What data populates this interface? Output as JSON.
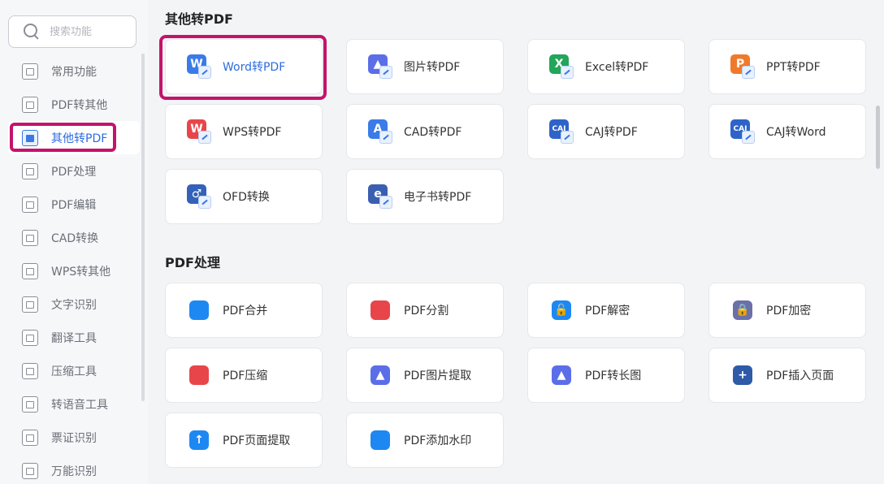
{
  "search": {
    "placeholder": "搜索功能"
  },
  "sidebar": {
    "items": [
      {
        "label": "常用功能",
        "icon": "common-tools-icon"
      },
      {
        "label": "PDF转其他",
        "icon": "pdf-to-other-icon"
      },
      {
        "label": "其他转PDF",
        "icon": "other-to-pdf-icon",
        "active": true
      },
      {
        "label": "PDF处理",
        "icon": "pdf-process-icon"
      },
      {
        "label": "PDF编辑",
        "icon": "pdf-edit-icon"
      },
      {
        "label": "CAD转换",
        "icon": "cad-convert-icon"
      },
      {
        "label": "WPS转其他",
        "icon": "wps-to-other-icon"
      },
      {
        "label": "文字识别",
        "icon": "ocr-icon"
      },
      {
        "label": "翻译工具",
        "icon": "translate-icon"
      },
      {
        "label": "压缩工具",
        "icon": "compress-icon"
      },
      {
        "label": "转语音工具",
        "icon": "text-to-speech-icon"
      },
      {
        "label": "票证识别",
        "icon": "ticket-recognition-icon"
      },
      {
        "label": "万能识别",
        "icon": "universal-recognition-icon"
      }
    ]
  },
  "sections": [
    {
      "title": "其他转PDF",
      "cards": [
        {
          "label": "Word转PDF",
          "icon": "word-to-pdf-icon",
          "glyph": "W",
          "color": "#3b7be8"
        },
        {
          "label": "图片转PDF",
          "icon": "image-to-pdf-icon",
          "glyph": "▲",
          "color": "#5b6ee8"
        },
        {
          "label": "Excel转PDF",
          "icon": "excel-to-pdf-icon",
          "glyph": "X",
          "color": "#23a55a"
        },
        {
          "label": "PPT转PDF",
          "icon": "ppt-to-pdf-icon",
          "glyph": "P",
          "color": "#f07a2b"
        },
        {
          "label": "WPS转PDF",
          "icon": "wps-to-pdf-icon",
          "glyph": "W",
          "color": "#e8454a"
        },
        {
          "label": "CAD转PDF",
          "icon": "cad-to-pdf-icon",
          "glyph": "A",
          "color": "#3b7be8"
        },
        {
          "label": "CAJ转PDF",
          "icon": "caj-to-pdf-icon",
          "glyph": "CAJ",
          "color": "#2e64c9"
        },
        {
          "label": "CAJ转Word",
          "icon": "caj-to-word-icon",
          "glyph": "CAJ",
          "color": "#2e64c9"
        },
        {
          "label": "OFD转换",
          "icon": "ofd-convert-icon",
          "glyph": "♂",
          "color": "#3462b8"
        },
        {
          "label": "电子书转PDF",
          "icon": "ebook-to-pdf-icon",
          "glyph": "e",
          "color": "#3a5fb0"
        }
      ]
    },
    {
      "title": "PDF处理",
      "cards": [
        {
          "label": "PDF合并",
          "icon": "pdf-merge-icon",
          "glyph": "",
          "color": "#1e88f2"
        },
        {
          "label": "PDF分割",
          "icon": "pdf-split-icon",
          "glyph": "",
          "color": "#e8454a"
        },
        {
          "label": "PDF解密",
          "icon": "pdf-decrypt-icon",
          "glyph": "🔓",
          "color": "#1e88f2"
        },
        {
          "label": "PDF加密",
          "icon": "pdf-encrypt-icon",
          "glyph": "🔒",
          "color": "#6b70a8"
        },
        {
          "label": "PDF压缩",
          "icon": "pdf-compress-icon",
          "glyph": "",
          "color": "#e8454a"
        },
        {
          "label": "PDF图片提取",
          "icon": "pdf-image-extract-icon",
          "glyph": "▲",
          "color": "#5b6ee8"
        },
        {
          "label": "PDF转长图",
          "icon": "pdf-to-long-image-icon",
          "glyph": "▲",
          "color": "#5b6ee8"
        },
        {
          "label": "PDF插入页面",
          "icon": "pdf-insert-page-icon",
          "glyph": "+",
          "color": "#2e5aa8"
        },
        {
          "label": "PDF页面提取",
          "icon": "pdf-page-extract-icon",
          "glyph": "↑",
          "color": "#1e88f2"
        },
        {
          "label": "PDF添加水印",
          "icon": "pdf-watermark-icon",
          "glyph": "",
          "color": "#1e88f2"
        }
      ]
    }
  ]
}
